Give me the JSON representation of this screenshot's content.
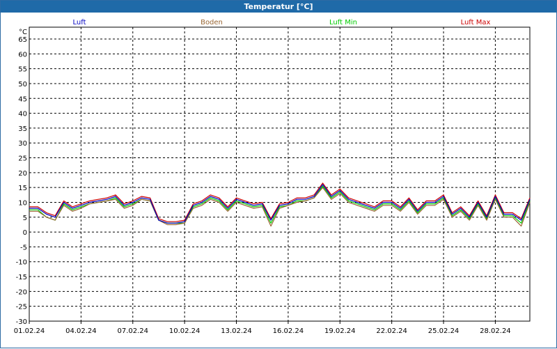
{
  "window": {
    "title": "Temperatur [°C]"
  },
  "chart_data": {
    "type": "line",
    "title": "Temperatur [°C]",
    "ylabel": "°C",
    "xlabel": "",
    "ylim": [
      -30,
      69
    ],
    "y_ticks": [
      65,
      60,
      55,
      50,
      45,
      40,
      35,
      30,
      25,
      20,
      15,
      10,
      5,
      0,
      -5,
      -10,
      -15,
      -20,
      -25,
      -30
    ],
    "x_range": [
      "01.02.24",
      "01.03.24"
    ],
    "x_ticks": [
      "01.02.24",
      "04.02.24",
      "07.02.24",
      "10.02.24",
      "13.02.24",
      "16.02.24",
      "19.02.24",
      "22.02.24",
      "25.02.24",
      "28.02.24"
    ],
    "grid": true,
    "legend_position": "top",
    "x": [
      "01.02.24 00:00",
      "01.02.24 12:00",
      "02.02.24 00:00",
      "02.02.24 12:00",
      "03.02.24 00:00",
      "03.02.24 12:00",
      "04.02.24 00:00",
      "04.02.24 12:00",
      "05.02.24 00:00",
      "05.02.24 12:00",
      "06.02.24 00:00",
      "06.02.24 12:00",
      "07.02.24 00:00",
      "07.02.24 12:00",
      "08.02.24 00:00",
      "08.02.24 12:00",
      "09.02.24 00:00",
      "09.02.24 12:00",
      "10.02.24 00:00",
      "10.02.24 12:00",
      "11.02.24 00:00",
      "11.02.24 12:00",
      "12.02.24 00:00",
      "12.02.24 12:00",
      "13.02.24 00:00",
      "13.02.24 12:00",
      "14.02.24 00:00",
      "14.02.24 12:00",
      "15.02.24 00:00",
      "15.02.24 12:00",
      "16.02.24 00:00",
      "16.02.24 12:00",
      "17.02.24 00:00",
      "17.02.24 12:00",
      "18.02.24 00:00",
      "18.02.24 12:00",
      "19.02.24 00:00",
      "19.02.24 12:00",
      "20.02.24 00:00",
      "20.02.24 12:00",
      "21.02.24 00:00",
      "21.02.24 12:00",
      "22.02.24 00:00",
      "22.02.24 12:00",
      "23.02.24 00:00",
      "23.02.24 12:00",
      "24.02.24 00:00",
      "24.02.24 12:00",
      "25.02.24 00:00",
      "25.02.24 12:00",
      "26.02.24 00:00",
      "26.02.24 12:00",
      "27.02.24 00:00",
      "27.02.24 12:00",
      "28.02.24 00:00",
      "28.02.24 12:00",
      "29.02.24 00:00",
      "29.02.24 12:00",
      "01.03.24 00:00"
    ],
    "series": [
      {
        "name": "Luft",
        "color": "#0000c0",
        "values": [
          8,
          8,
          6,
          5,
          10,
          8,
          9,
          10,
          10.5,
          11,
          12,
          9,
          10,
          11.5,
          11,
          4,
          3,
          3,
          3.5,
          9,
          10,
          12,
          11,
          8,
          11,
          10,
          9,
          9.5,
          4,
          9,
          9.5,
          11,
          11,
          12,
          16,
          12,
          14,
          11,
          10,
          9,
          8,
          10,
          10,
          8,
          11,
          7,
          10,
          10,
          12,
          6,
          8,
          5,
          10,
          5,
          12,
          6,
          6,
          4,
          11
        ]
      },
      {
        "name": "Boden",
        "color": "#996633",
        "values": [
          7,
          7,
          5,
          4,
          9,
          7,
          8,
          9.5,
          10,
          10.5,
          11,
          8,
          9,
          11,
          10.5,
          4,
          2.5,
          2.5,
          3,
          8,
          9,
          11,
          10,
          7,
          10,
          9,
          8,
          8.5,
          2,
          8,
          9,
          10,
          10.5,
          11.5,
          15,
          11,
          13,
          10,
          9,
          8,
          7,
          9,
          9,
          7,
          10,
          6,
          9,
          9,
          11,
          5,
          7,
          4,
          9,
          4,
          11,
          5,
          5,
          2,
          10
        ]
      },
      {
        "name": "Luft Min",
        "color": "#00cc00",
        "values": [
          7.5,
          7.5,
          5,
          4,
          9.5,
          7.5,
          8.5,
          9.5,
          10,
          10.5,
          11.5,
          8.5,
          9.5,
          11,
          10.5,
          4,
          3,
          3,
          3,
          8.5,
          9.5,
          11.5,
          10.5,
          7.5,
          10.5,
          9.5,
          8.5,
          9,
          3,
          8.5,
          9,
          10.5,
          10.5,
          11.5,
          15.5,
          11.5,
          13.5,
          10.5,
          9.5,
          8.5,
          7.5,
          9.5,
          9.5,
          7.5,
          10.5,
          6.5,
          9.5,
          9.5,
          11.5,
          5.5,
          7.5,
          4.5,
          9.5,
          4.5,
          11.5,
          5.5,
          5.5,
          3,
          10.5
        ]
      },
      {
        "name": "Luft Max",
        "color": "#cc0000",
        "values": [
          8.5,
          8.5,
          6.5,
          5.5,
          10.5,
          8.5,
          9.5,
          10.5,
          11,
          11.5,
          12.5,
          9.5,
          10.5,
          12,
          11.5,
          4.5,
          3.5,
          3.5,
          4,
          9.5,
          10.5,
          12.5,
          11.5,
          8.5,
          11.5,
          10.5,
          9.5,
          10,
          4.5,
          9.5,
          10,
          11.5,
          11.5,
          12.5,
          16.5,
          12.5,
          14.5,
          11.5,
          10.5,
          9.5,
          8.5,
          10.5,
          10.5,
          8.5,
          11.5,
          7.5,
          10.5,
          10.5,
          12.5,
          6.5,
          8.5,
          5.5,
          10.5,
          5.5,
          12.5,
          6.5,
          6.5,
          4.5,
          11.5
        ]
      }
    ]
  }
}
